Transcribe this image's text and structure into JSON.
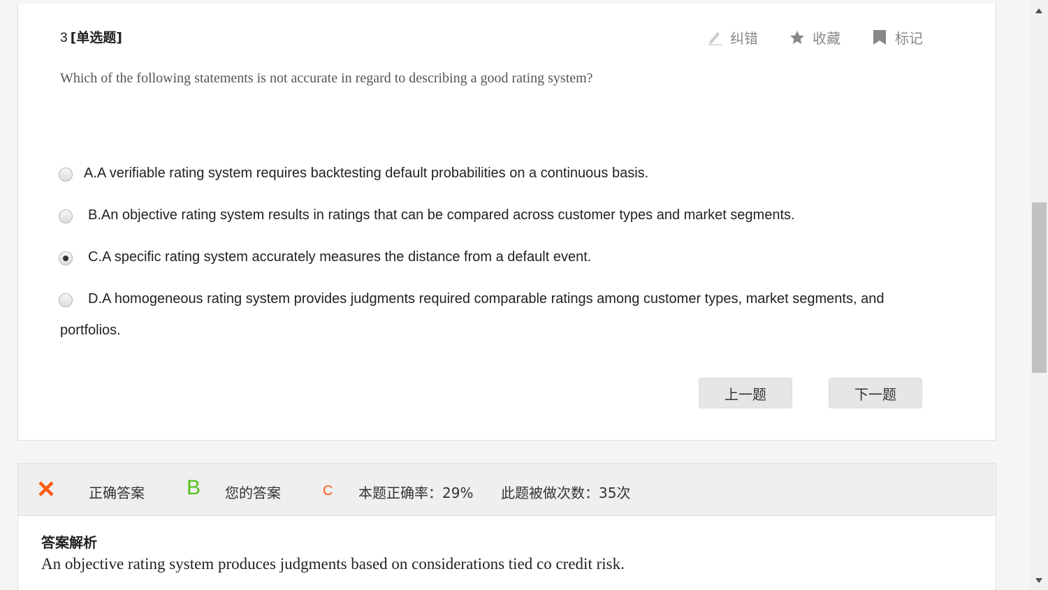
{
  "question": {
    "number": "3",
    "type": "[单选题]",
    "text": "Which of the following statements is not accurate in regard to describing a good rating system?",
    "tools": {
      "report_label": "纠错",
      "favorite_label": "收藏",
      "mark_label": "标记"
    },
    "options": [
      {
        "label": "A.A verifiable rating system requires backtesting default probabilities on a continuous basis.",
        "selected": false
      },
      {
        "label": "B.An objective rating system results in ratings that can be compared across customer types and market segments.",
        "selected": false
      },
      {
        "label": "C.A specific rating system accurately measures the distance from a default event.",
        "selected": true
      },
      {
        "label": "D.A homogeneous rating system provides judgments required comparable ratings among customer types, market segments, and",
        "selected": false
      }
    ],
    "option_d_continuation": "portfolios.",
    "prev_label": "上一题",
    "next_label": "下一题"
  },
  "answer_bar": {
    "correct_label": "正确答案",
    "correct_value": "B",
    "your_label": "您的答案",
    "your_value": "C",
    "accuracy": "本题正确率：29%",
    "attempts": "此题被做次数：35次"
  },
  "analysis": {
    "title": "答案解析",
    "text": "An objective rating system produces judgments based on considerations tied co credit risk."
  },
  "colors": {
    "correct": "#55c21e",
    "wrong": "#ff5a14",
    "tool_icon": "#888888"
  }
}
